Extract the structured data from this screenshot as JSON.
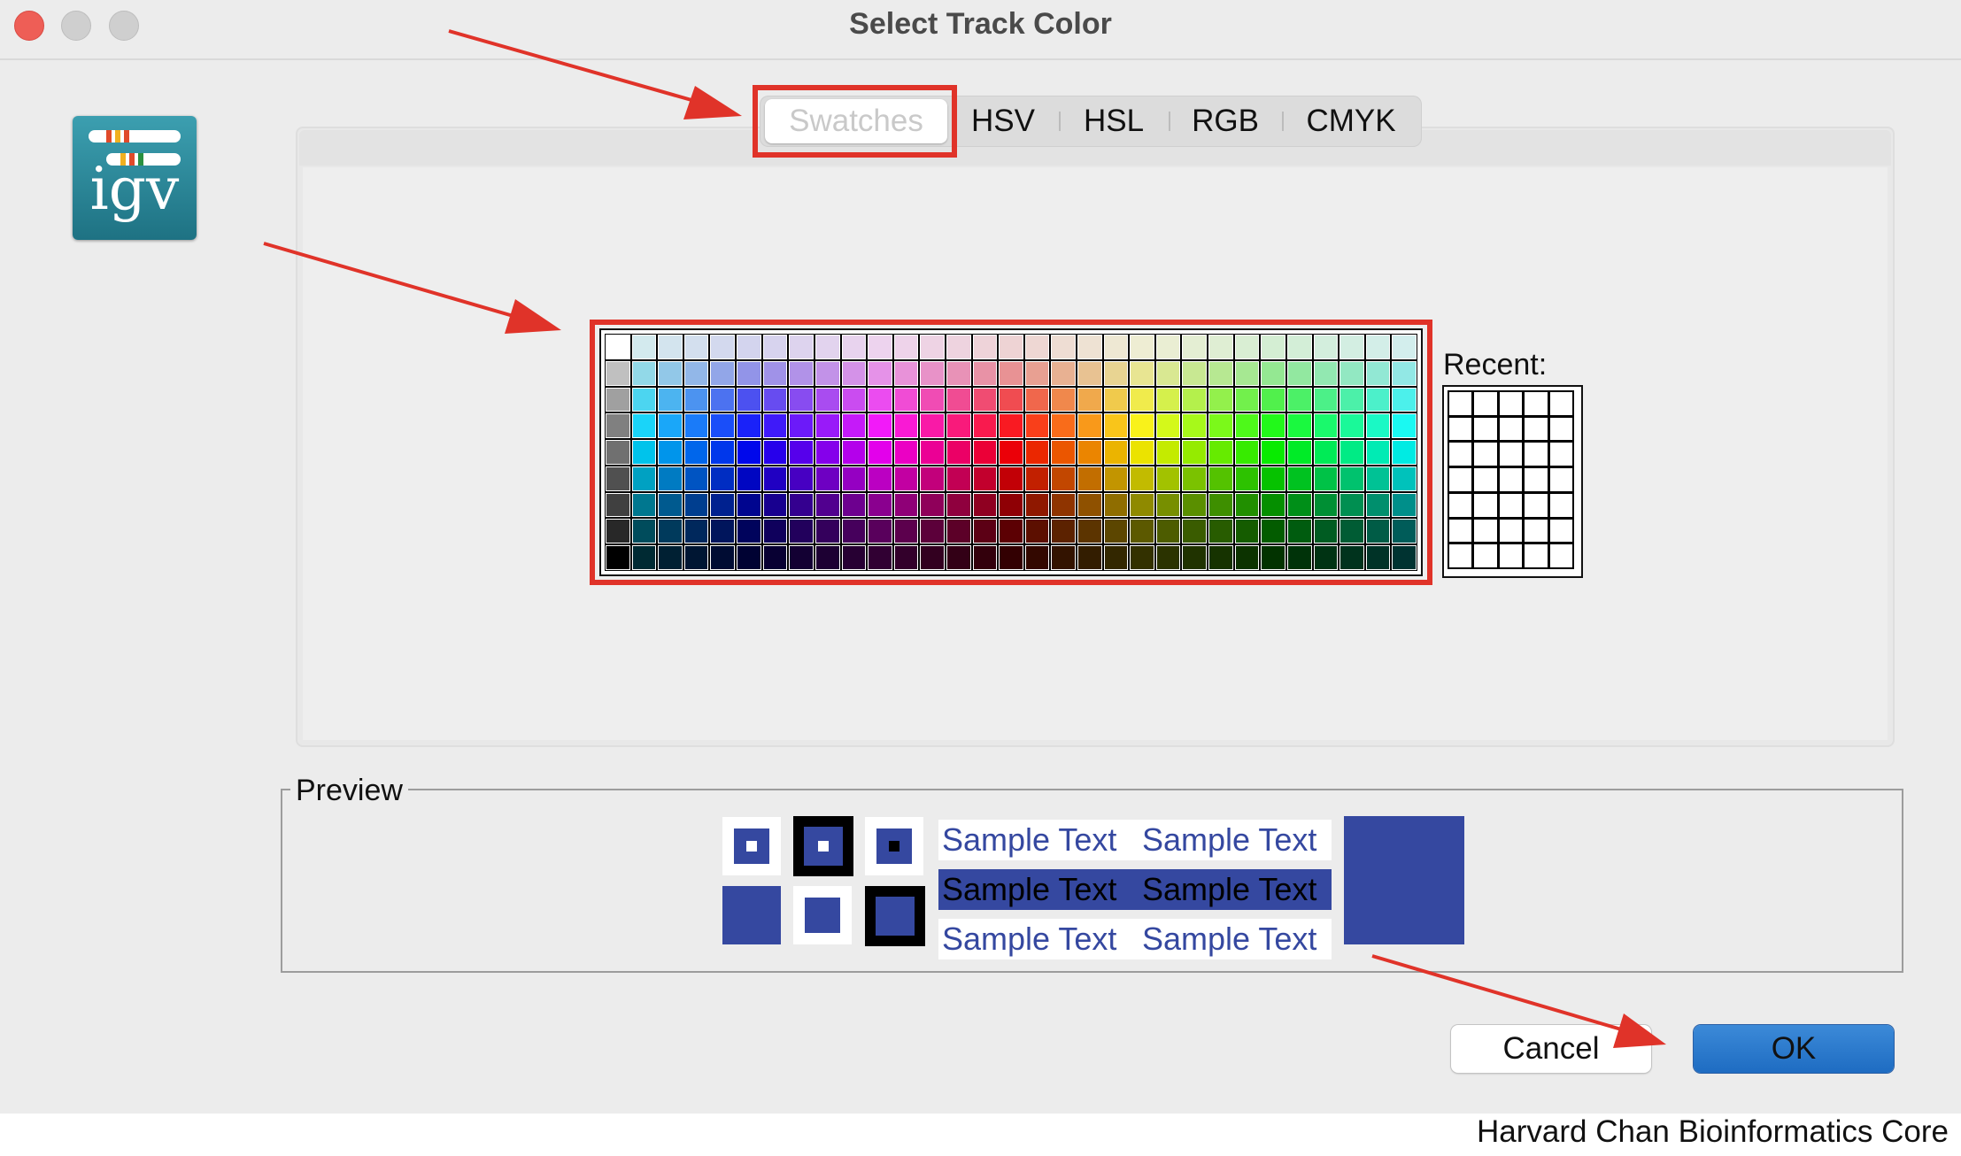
{
  "window": {
    "title": "Select Track Color"
  },
  "logo": {
    "text": "igv"
  },
  "tabs": [
    {
      "label": "Swatches",
      "selected": true
    },
    {
      "label": "HSV",
      "selected": false
    },
    {
      "label": "HSL",
      "selected": false
    },
    {
      "label": "RGB",
      "selected": false
    },
    {
      "label": "CMYK",
      "selected": false
    }
  ],
  "swatches": {
    "recent_label": "Recent:",
    "selected_color": "#3548a0"
  },
  "preview": {
    "label": "Preview",
    "sample_text": "Sample Text",
    "color": "#3548a0"
  },
  "buttons": {
    "cancel": "Cancel",
    "ok": "OK"
  },
  "footer": {
    "credit": "Harvard Chan Bioinformatics Core"
  },
  "colors": {
    "annotation": "#e03329",
    "accent": "#2a78d0"
  }
}
